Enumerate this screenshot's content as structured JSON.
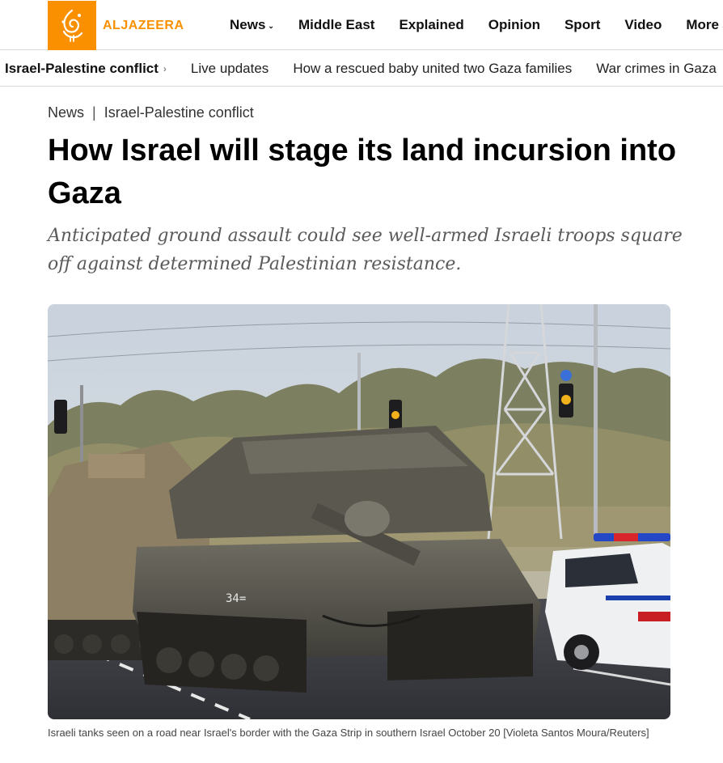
{
  "brand": {
    "name": "ALJAZEERA",
    "color": "#fa9000"
  },
  "main_nav": [
    {
      "label": "News",
      "dropdown": true
    },
    {
      "label": "Middle East",
      "dropdown": false
    },
    {
      "label": "Explained",
      "dropdown": false
    },
    {
      "label": "Opinion",
      "dropdown": false
    },
    {
      "label": "Sport",
      "dropdown": false
    },
    {
      "label": "Video",
      "dropdown": false
    },
    {
      "label": "More",
      "dropdown": true
    }
  ],
  "sub_nav": {
    "topic": "Israel-Palestine conflict",
    "items": [
      "Live updates",
      "How a rescued baby united two Gaza families",
      "War crimes in Gaza"
    ]
  },
  "breadcrumb": {
    "section": "News",
    "separator": "|",
    "topic": "Israel-Palestine conflict"
  },
  "article": {
    "title": "How Israel will stage its land incursion into Gaza",
    "subtitle": "Anticipated ground assault could see well-armed Israeli troops square off against determined Palestinian resistance.",
    "image": {
      "tank_marking": "34=",
      "caption": "Israeli tanks seen on a road near Israel's border with the Gaza Strip in southern Israel October 20 [Violeta Santos Moura/Reuters]"
    }
  }
}
